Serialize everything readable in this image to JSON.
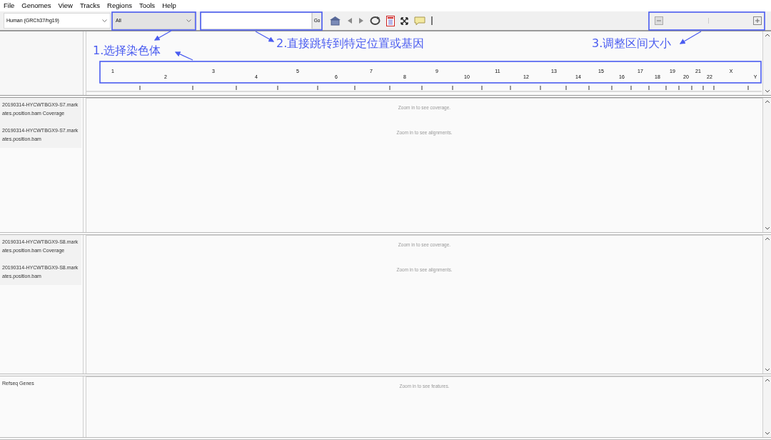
{
  "menu": [
    "File",
    "Genomes",
    "View",
    "Tracks",
    "Regions",
    "Tools",
    "Help"
  ],
  "toolbar": {
    "genome": "Human (GRCh37/hg19)",
    "chromosome": "All",
    "go_button": "Go"
  },
  "ruler": {
    "chromosomes": [
      "1",
      "2",
      "3",
      "4",
      "5",
      "6",
      "7",
      "8",
      "9",
      "10",
      "11",
      "12",
      "13",
      "14",
      "15",
      "16",
      "17",
      "18",
      "19",
      "20",
      "21",
      "22",
      "X",
      "Y"
    ]
  },
  "panels": [
    {
      "tracks": [
        {
          "name": "20190314-HYCWTBGX9-S7.markates.position.bam Coverage",
          "message": "Zoom in to see coverage."
        },
        {
          "name": "20190314-HYCWTBGX9-S7.markates.position.bam",
          "message": "Zoom in to see alignments."
        }
      ]
    },
    {
      "tracks": [
        {
          "name": "20190314-HYCWTBGX9-S8.markates.position.bam Coverage",
          "message": "Zoom in to see coverage."
        },
        {
          "name": "20190314-HYCWTBGX9-S8.markates.position.bam",
          "message": "Zoom in to see alignments."
        }
      ]
    },
    {
      "tracks": [
        {
          "name": "Refseq Genes",
          "message": "Zoom in to see features."
        }
      ]
    }
  ],
  "annotations": [
    "1.选择染色体",
    "2.直接跳转到特定位置或基因",
    "3.调整区间大小"
  ]
}
